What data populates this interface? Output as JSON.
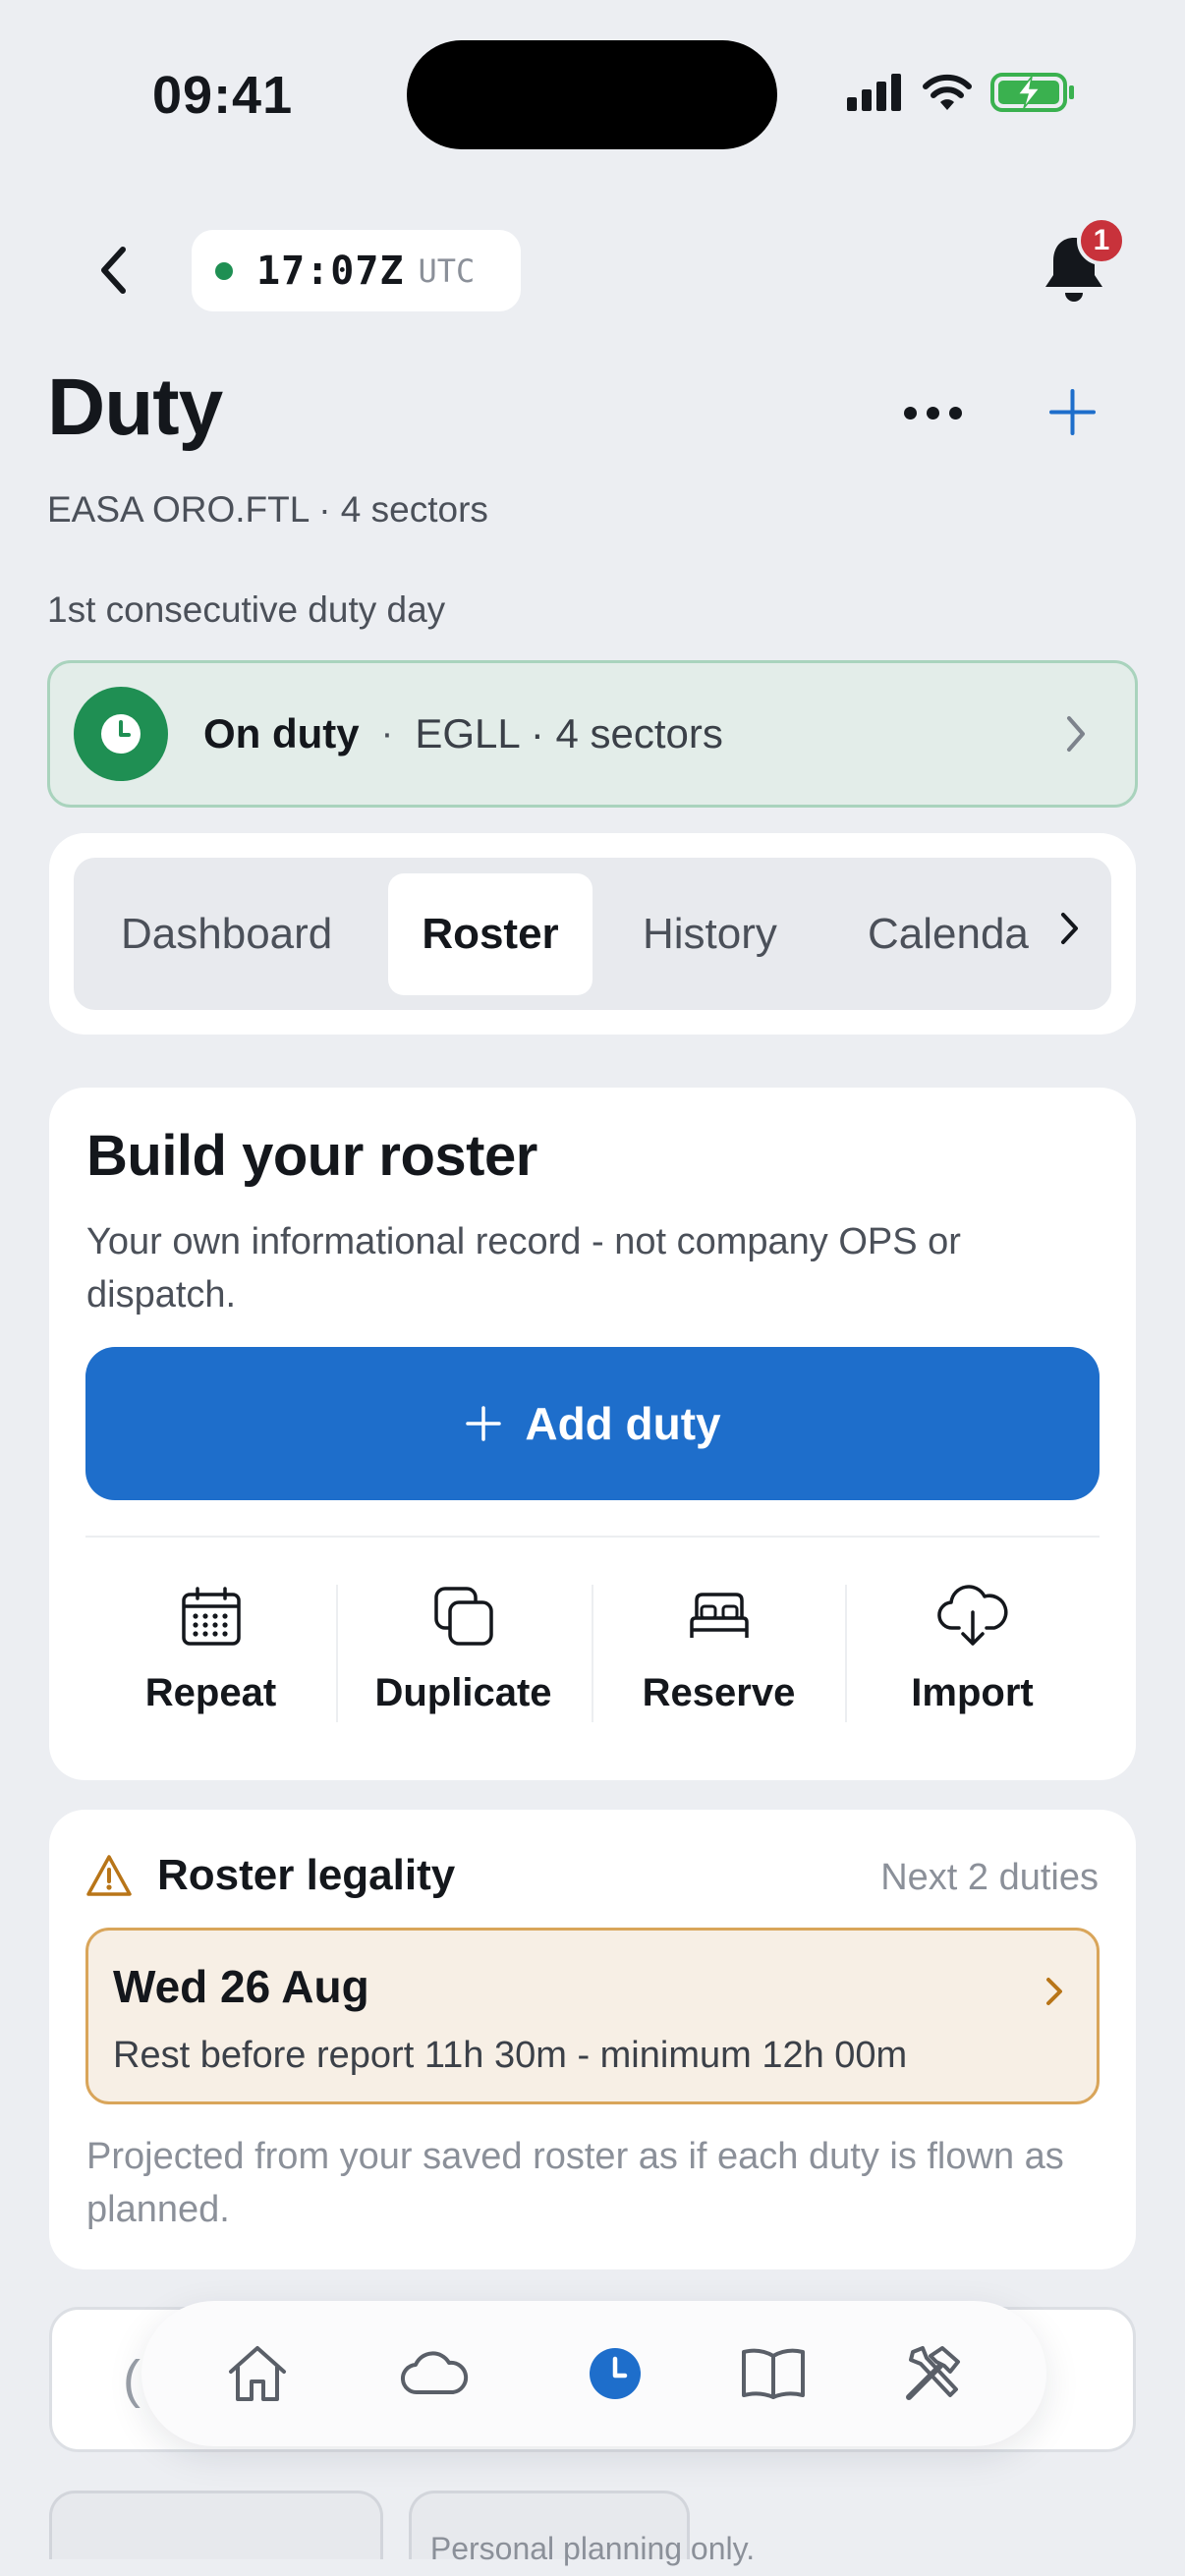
{
  "status_bar": {
    "time": "09:41"
  },
  "header": {
    "clock_time": "17:07Z",
    "clock_zone": "UTC",
    "notification_count": "1",
    "title": "Duty",
    "subtitle": "EASA ORO.FTL · 4 sectors",
    "duty_day": "1st consecutive duty day"
  },
  "on_duty": {
    "status": "On duty",
    "separator": "·",
    "detail": "EGLL · 4 sectors",
    "accent": "#1f8f53"
  },
  "tabs": [
    {
      "label": "Dashboard",
      "active": false
    },
    {
      "label": "Roster",
      "active": true
    },
    {
      "label": "History",
      "active": false
    },
    {
      "label": "Calenda",
      "active": false
    }
  ],
  "build": {
    "title": "Build your roster",
    "description": "Your own informational record - not company OPS or dispatch.",
    "add_label": "Add duty",
    "accent": "#1e6ecb",
    "actions": [
      {
        "label": "Repeat",
        "icon": "calendar-grid-icon"
      },
      {
        "label": "Duplicate",
        "icon": "copy-icon"
      },
      {
        "label": "Reserve",
        "icon": "bed-icon"
      },
      {
        "label": "Import",
        "icon": "cloud-download-icon"
      }
    ]
  },
  "legality": {
    "title": "Roster legality",
    "scope": "Next 2 duties",
    "item_date": "Wed 26 Aug",
    "item_message": "Rest before report 11h 30m - minimum 12h 00m",
    "footnote": "Projected from your saved roster as if each duty is flown as planned.",
    "warning_color": "#b87518"
  },
  "tab_bar": [
    {
      "icon": "home-icon",
      "active": false
    },
    {
      "icon": "cloud-icon",
      "active": false
    },
    {
      "icon": "duty-clock-icon",
      "active": true
    },
    {
      "icon": "book-icon",
      "active": false
    },
    {
      "icon": "tools-icon",
      "active": false
    }
  ],
  "footer": {
    "note": "Personal planning only."
  }
}
